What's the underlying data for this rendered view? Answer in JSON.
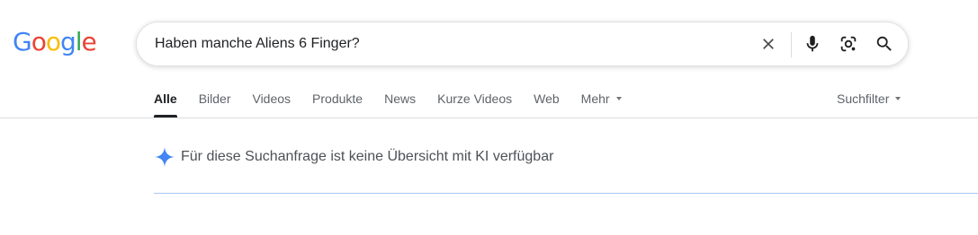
{
  "logo": {
    "letters": [
      {
        "char": "G",
        "color": "#4285F4"
      },
      {
        "char": "o",
        "color": "#EA4335"
      },
      {
        "char": "o",
        "color": "#FBBC05"
      },
      {
        "char": "g",
        "color": "#4285F4"
      },
      {
        "char": "l",
        "color": "#34A853"
      },
      {
        "char": "e",
        "color": "#EA4335"
      }
    ]
  },
  "search": {
    "query": "Haben manche Aliens 6 Finger?",
    "icons": [
      "close-icon",
      "microphone-icon",
      "lens-icon",
      "search-icon"
    ]
  },
  "tabs": [
    {
      "label": "Alle",
      "active": true
    },
    {
      "label": "Bilder",
      "active": false
    },
    {
      "label": "Videos",
      "active": false
    },
    {
      "label": "Produkte",
      "active": false
    },
    {
      "label": "News",
      "active": false
    },
    {
      "label": "Kurze Videos",
      "active": false
    },
    {
      "label": "Web",
      "active": false
    },
    {
      "label": "Mehr",
      "active": false,
      "dropdown": true
    }
  ],
  "filter": {
    "label": "Suchfilter",
    "dropdown": true
  },
  "ai_overview": {
    "message": "Für diese Suchanfrage ist keine Übersicht mit KI verfügbar",
    "icon": "sparkle-icon",
    "accent": "#4285F4"
  },
  "colors": {
    "text_primary": "#202124",
    "text_secondary": "#5f6368",
    "divider": "#dadce0"
  }
}
